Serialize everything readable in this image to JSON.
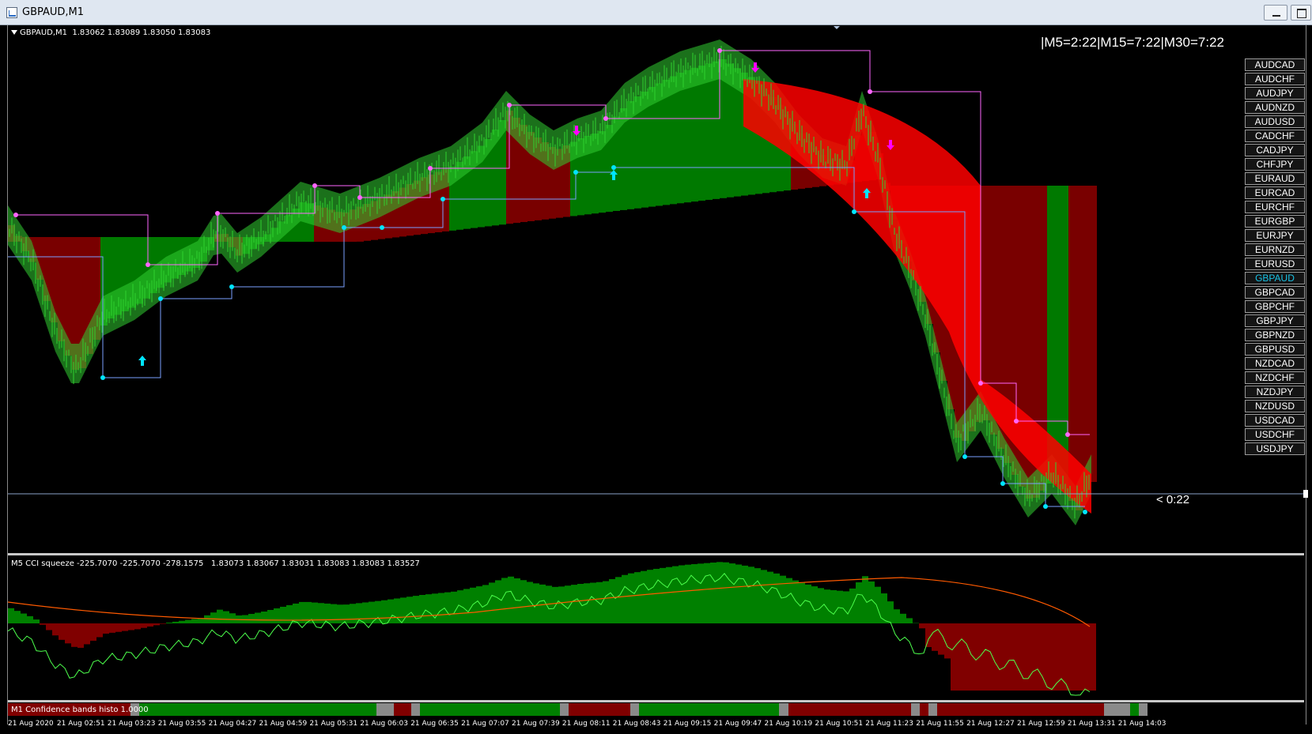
{
  "window": {
    "title": "GBPAUD,M1"
  },
  "chart": {
    "header": "GBPAUD,M1  1.83062 1.83089 1.83050 1.83083",
    "timer": "|M5=2:22|M15=7:22|M30=7:22",
    "countdown": "< 0:22"
  },
  "symbols": [
    "AUDCAD",
    "AUDCHF",
    "AUDJPY",
    "AUDNZD",
    "AUDUSD",
    "CADCHF",
    "CADJPY",
    "CHFJPY",
    "EURAUD",
    "EURCAD",
    "EURCHF",
    "EURGBP",
    "EURJPY",
    "EURNZD",
    "EURUSD",
    "GBPAUD",
    "GBPCAD",
    "GBPCHF",
    "GBPJPY",
    "GBPNZD",
    "GBPUSD",
    "NZDCAD",
    "NZDCHF",
    "NZDJPY",
    "NZDUSD",
    "USDCAD",
    "USDCHF",
    "USDJPY"
  ],
  "active_symbol": "GBPAUD",
  "subwindow1": {
    "label": "M5 CCI squeeze -225.7070 -225.7070 -278.1575   1.83073 1.83067 1.83031 1.83083 1.83083 1.83527"
  },
  "subwindow2": {
    "label": "M1 Confidence bands histo 1.0000"
  },
  "time_axis": [
    "21 Aug 2020",
    "21 Aug 02:51",
    "21 Aug 03:23",
    "21 Aug 03:55",
    "21 Aug 04:27",
    "21 Aug 04:59",
    "21 Aug 05:31",
    "21 Aug 06:03",
    "21 Aug 06:35",
    "21 Aug 07:07",
    "21 Aug 07:39",
    "21 Aug 08:11",
    "21 Aug 08:43",
    "21 Aug 09:15",
    "21 Aug 09:47",
    "21 Aug 10:19",
    "21 Aug 10:51",
    "21 Aug 11:23",
    "21 Aug 11:55",
    "21 Aug 12:27",
    "21 Aug 12:59",
    "21 Aug 13:31",
    "21 Aug 14:03"
  ],
  "colors": {
    "bull": "#008000",
    "bear": "#800000",
    "bright_bull": "#32cd32",
    "bright_bear": "#ff0000",
    "candle": "#2fd12f",
    "up_arrow": "#00e5ff",
    "down_arrow": "#ff00ff",
    "resistance": "#ff66ff",
    "support": "#7aa0ff"
  },
  "confidence_segments": [
    {
      "state": "bear",
      "w": 14
    },
    {
      "state": "neutral",
      "w": 1
    },
    {
      "state": "bull",
      "w": 27
    },
    {
      "state": "neutral",
      "w": 2
    },
    {
      "state": "bear",
      "w": 2
    },
    {
      "state": "neutral",
      "w": 1
    },
    {
      "state": "bull",
      "w": 16
    },
    {
      "state": "neutral",
      "w": 1
    },
    {
      "state": "bear",
      "w": 7
    },
    {
      "state": "neutral",
      "w": 1
    },
    {
      "state": "bull",
      "w": 16
    },
    {
      "state": "neutral",
      "w": 1
    },
    {
      "state": "bear",
      "w": 14
    },
    {
      "state": "neutral",
      "w": 1
    },
    {
      "state": "bear",
      "w": 1
    },
    {
      "state": "neutral",
      "w": 1
    },
    {
      "state": "bear",
      "w": 19
    },
    {
      "state": "neutral",
      "w": 3
    },
    {
      "state": "bull",
      "w": 1
    },
    {
      "state": "neutral",
      "w": 1
    }
  ]
}
